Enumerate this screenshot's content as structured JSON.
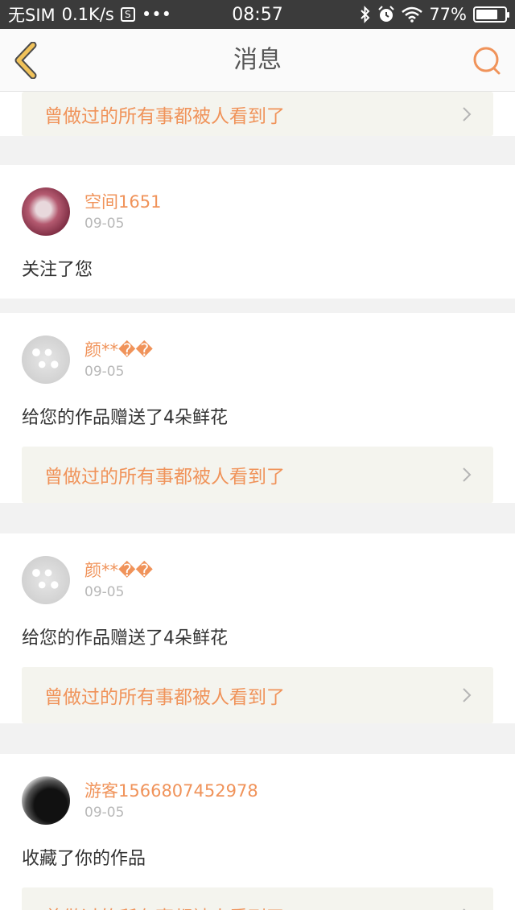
{
  "status_bar": {
    "carrier": "无SIM",
    "speed": "0.1K/s",
    "sim_icon_glyph": "S",
    "more": "•••",
    "time": "08:57",
    "battery_percent": "77%",
    "battery_level": 0.77
  },
  "nav": {
    "title": "消息",
    "back_icon": "chevron-left-icon",
    "search_icon": "search-icon",
    "accent": "#f0c25a",
    "search_color": "#f0935a"
  },
  "top_quote": {
    "text": "曾做过的所有事都被人看到了"
  },
  "messages": [
    {
      "user": "空间1651",
      "date": "09-05",
      "action": "关注了您"
    },
    {
      "user": "颜**��",
      "date": "09-05",
      "action": "给您的作品赠送了4朵鲜花",
      "quote": "曾做过的所有事都被人看到了"
    },
    {
      "user": "颜**��",
      "date": "09-05",
      "action": "给您的作品赠送了4朵鲜花",
      "quote": "曾做过的所有事都被人看到了"
    },
    {
      "user": "游客1566807452978",
      "date": "09-05",
      "action": "收藏了你的作品",
      "quote": "曾做过的所有事都被人看到了"
    }
  ]
}
